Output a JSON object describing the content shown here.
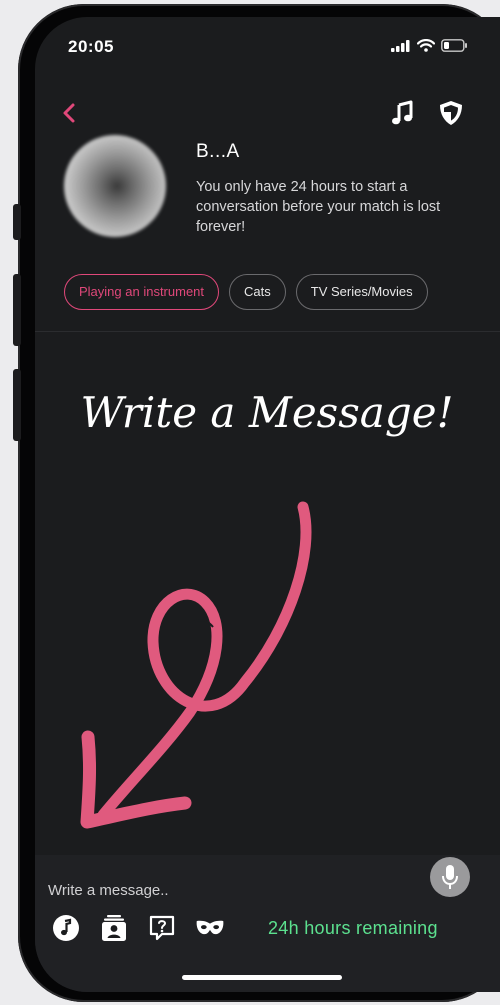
{
  "status_bar": {
    "time": "20:05"
  },
  "nav": {
    "back_icon": "chevron-left-icon",
    "music_icon": "music-note-icon",
    "shield_icon": "shield-icon",
    "accent_color": "#e0487a"
  },
  "match": {
    "name": "B...A",
    "notice": "You only have 24 hours to start a conversation before your match is lost forever!"
  },
  "interests": [
    {
      "label": "Playing an instrument",
      "active": true
    },
    {
      "label": "Cats",
      "active": false
    },
    {
      "label": "TV Series/Movies",
      "active": false
    }
  ],
  "promo": {
    "headline": "Write a Message!",
    "arrow_color": "#e05a7e"
  },
  "composer": {
    "placeholder": "Write a message..",
    "remaining": "24h hours remaining",
    "remaining_color": "#5ce18f",
    "tools": [
      "music-note-icon",
      "contact-card-icon",
      "question-icon",
      "mask-icon"
    ],
    "mic_icon": "microphone-icon"
  }
}
